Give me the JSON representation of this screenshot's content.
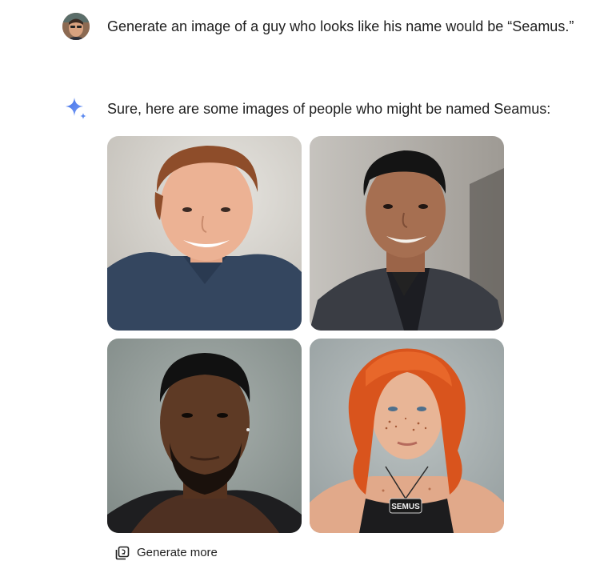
{
  "user_message": {
    "avatar_icon": "user-avatar-photo",
    "text": "Generate an image of a guy who looks like his name would be “Seamus.”"
  },
  "model_response": {
    "icon": "gemini-sparkle-icon",
    "text": "Sure, here are some images of people who might be named Seamus:",
    "images": [
      {
        "name": "generated-image-1",
        "badge": ""
      },
      {
        "name": "generated-image-2",
        "badge": ""
      },
      {
        "name": "generated-image-3",
        "badge": ""
      },
      {
        "name": "generated-image-4",
        "badge": "SEMUS"
      }
    ],
    "generate_more_label": "Generate more",
    "generate_more_icon": "image-stack-icon"
  },
  "colors": {
    "sparkle_blue": "#4a80f0",
    "text": "#1f1f1f",
    "background": "#ffffff"
  }
}
